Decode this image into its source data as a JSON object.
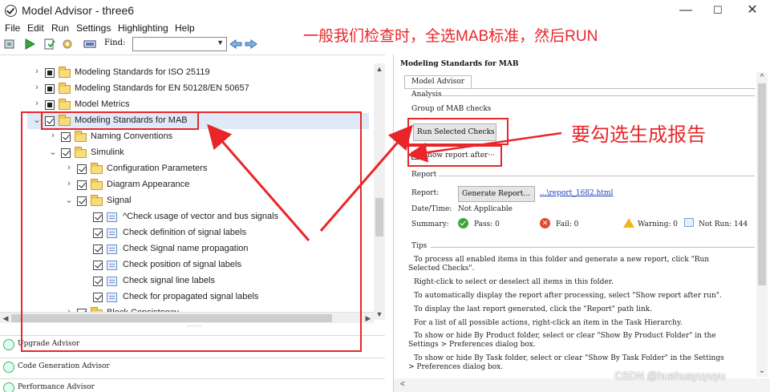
{
  "window": {
    "title": "Model Advisor - three6",
    "minimize": "—",
    "maximize": "☐",
    "close": "✕"
  },
  "menu": [
    "File",
    "Edit",
    "Run",
    "Settings",
    "Highlighting",
    "Help"
  ],
  "toolbar": {
    "find_label": "Find:",
    "find_value": ""
  },
  "annotations": {
    "top": "一般我们检查时，全选MAB标准，然后RUN",
    "right": "要勾选生成报告"
  },
  "tree": [
    {
      "label": "Modeling Standards for ISO 25119",
      "expander": "›",
      "state": "mixed",
      "icon": "folder",
      "selected": false
    },
    {
      "label": "Modeling Standards for EN 50128/EN 50657",
      "expander": "›",
      "state": "mixed",
      "icon": "folder",
      "selected": false
    },
    {
      "label": "Model Metrics",
      "expander": "›",
      "state": "mixed",
      "icon": "folder",
      "selected": false
    },
    {
      "label": "Modeling Standards for MAB",
      "expander": "⌄",
      "state": "checked",
      "icon": "folder",
      "selected": true
    },
    {
      "label": "Naming Conventions",
      "expander": "›",
      "state": "checked",
      "icon": "folder",
      "selected": false
    },
    {
      "label": "Simulink",
      "expander": "⌄",
      "state": "checked",
      "icon": "folder",
      "selected": false
    },
    {
      "label": "Configuration Parameters",
      "expander": "›",
      "state": "checked",
      "icon": "folder",
      "selected": false
    },
    {
      "label": "Diagram Appearance",
      "expander": "›",
      "state": "checked",
      "icon": "folder",
      "selected": false
    },
    {
      "label": "Signal",
      "expander": "⌄",
      "state": "checked",
      "icon": "folder",
      "selected": false
    },
    {
      "label": "^Check usage of vector and bus signals",
      "expander": "",
      "state": "checked",
      "icon": "doc",
      "selected": false
    },
    {
      "label": "Check definition of signal labels",
      "expander": "",
      "state": "checked",
      "icon": "doc",
      "selected": false
    },
    {
      "label": "Check Signal name propagation",
      "expander": "",
      "state": "checked",
      "icon": "doc",
      "selected": false
    },
    {
      "label": "Check position of signal labels",
      "expander": "",
      "state": "checked",
      "icon": "doc",
      "selected": false
    },
    {
      "label": "Check signal line labels",
      "expander": "",
      "state": "checked",
      "icon": "doc",
      "selected": false
    },
    {
      "label": "Check for propagated signal labels",
      "expander": "",
      "state": "checked",
      "icon": "doc",
      "selected": false
    },
    {
      "label": "Block Consistency",
      "expander": "›",
      "state": "checked",
      "icon": "folder",
      "selected": false
    }
  ],
  "advisors": [
    "Upgrade Advisor",
    "Code Generation Advisor",
    "Performance Advisor"
  ],
  "report_panel": {
    "title": "Modeling Standards for MAB",
    "tab": "Model Advisor",
    "analysis_header": "Analysis",
    "analysis_desc": "Group of MAB checks",
    "run_button": "Run Selected Checks",
    "show_report": "Show report after···",
    "report_header": "Report",
    "report_label": "Report:",
    "generate_button": "Generate Report...",
    "report_link": "...\\report_1682.html",
    "datetime_label": "Date/Time:",
    "datetime_value": "Not Applicable",
    "summary_label": "Summary:",
    "pass": "Pass: 0",
    "fail": "Fail: 0",
    "warning": "Warning: 0",
    "not_run": "Not Run: 144",
    "tips_header": "Tips",
    "tips": [
      "To process all enabled items in this folder and generate a new report, click \"Run",
      "Selected Checks\".",
      "Right-click to select or deselect all items in this folder.",
      "To automatically display the report after processing, select \"Show report after run\".",
      "To display the last report generated, click the \"Report\" path link.",
      "For a list of all possible actions, right-click an item in the Task Hierarchy.",
      "To show or hide By Product folder, select or clear \"Show By Product Folder\" in the",
      "Settings > Preferences dialog box.",
      "To show or hide By Task folder, select or clear \"Show By Task Folder\" in the Settings",
      "> Preferences dialog box."
    ]
  },
  "watermark": "CSDN @huahuayuyuyu",
  "colors": {
    "annotation_red": "#e8262a",
    "selection_blue": "#dfe9f7",
    "link_blue": "#1a3fbf"
  }
}
